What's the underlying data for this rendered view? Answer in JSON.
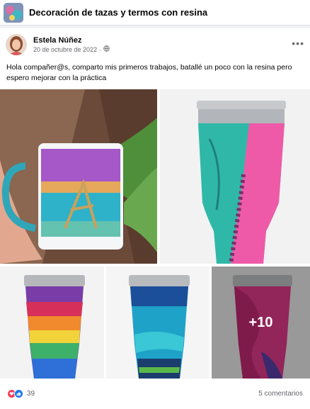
{
  "group": {
    "title": "Decoración de tazas y termos con resina",
    "thumb_icon": "group-cover-icon"
  },
  "post": {
    "author": "Estela Núñez",
    "date": "20 de octubre de 2022",
    "separator": "·",
    "privacy_icon": "globe-icon",
    "more_icon": "ellipsis-icon",
    "text": "Hola compañer@s,  comparto mis primeros trabajos, batallé un poco con la resina pero espero mejorar con la práctica",
    "photos": [
      {
        "name": "mug-photo",
        "icon": "mug-photo"
      },
      {
        "name": "tumbler-pink-teal-photo",
        "icon": "tumbler-photo"
      },
      {
        "name": "tumbler-rainbow-photo",
        "icon": "tumbler-photo"
      },
      {
        "name": "tumbler-blue-photo",
        "icon": "tumbler-photo"
      },
      {
        "name": "tumbler-pink-photo",
        "icon": "tumbler-photo",
        "overlay": "+10"
      }
    ],
    "reactions": {
      "count": "39",
      "icons": [
        "love-reaction-icon",
        "like-reaction-icon"
      ]
    },
    "comments": "5 comentarios"
  },
  "colors": {
    "page_bg": "#f0f2f5",
    "card_bg": "#ffffff",
    "secondary_text": "#65676b",
    "love": "#f33e58",
    "like": "#1877f2"
  }
}
